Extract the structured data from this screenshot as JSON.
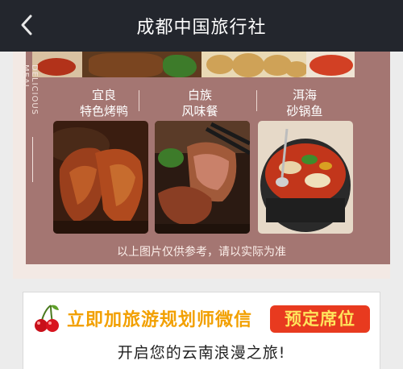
{
  "nav": {
    "title": "成都中国旅行社",
    "back_icon": "chevron-left-icon"
  },
  "card": {
    "vertical_label": "DELICIOUS MEAL",
    "dishes": [
      {
        "line1": "宜良",
        "line2": "特色烤鸭"
      },
      {
        "line1": "白族",
        "line2": "风味餐"
      },
      {
        "line1": "洱海",
        "line2": "砂锅鱼"
      }
    ],
    "disclaimer": "以上图片仅供参考，请以实际为准"
  },
  "cta": {
    "icon": "cherry-icon",
    "headline": "立即加旅游规划师微信",
    "badge": "预定席位",
    "subline": "开启您的云南浪漫之旅!"
  },
  "colors": {
    "nav_bg": "#23262d",
    "card_bg": "#a47672",
    "cta_orange": "#f2a000",
    "badge_red": "#e83a1f",
    "badge_text": "#ffe45c"
  }
}
